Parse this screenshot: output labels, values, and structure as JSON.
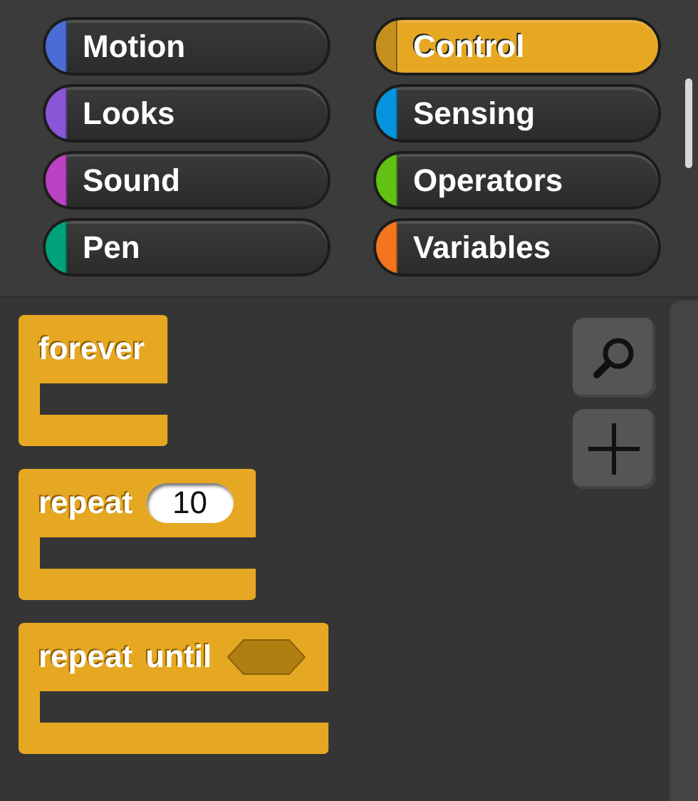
{
  "categories": [
    {
      "name": "Motion",
      "color": "#4a6cd4",
      "selected": false
    },
    {
      "name": "Control",
      "color": "#e6a822",
      "selected": true
    },
    {
      "name": "Looks",
      "color": "#8a55d7",
      "selected": false
    },
    {
      "name": "Sensing",
      "color": "#0494dc",
      "selected": false
    },
    {
      "name": "Sound",
      "color": "#bb42c3",
      "selected": false
    },
    {
      "name": "Operators",
      "color": "#62c213",
      "selected": false
    },
    {
      "name": "Pen",
      "color": "#00a178",
      "selected": false
    },
    {
      "name": "Variables",
      "color": "#f3761d",
      "selected": false
    }
  ],
  "blocks": [
    {
      "label": "forever"
    },
    {
      "label": "repeat",
      "slot": {
        "kind": "number",
        "value": "10"
      }
    },
    {
      "label": "repeat until",
      "slot": {
        "kind": "boolean"
      }
    }
  ]
}
